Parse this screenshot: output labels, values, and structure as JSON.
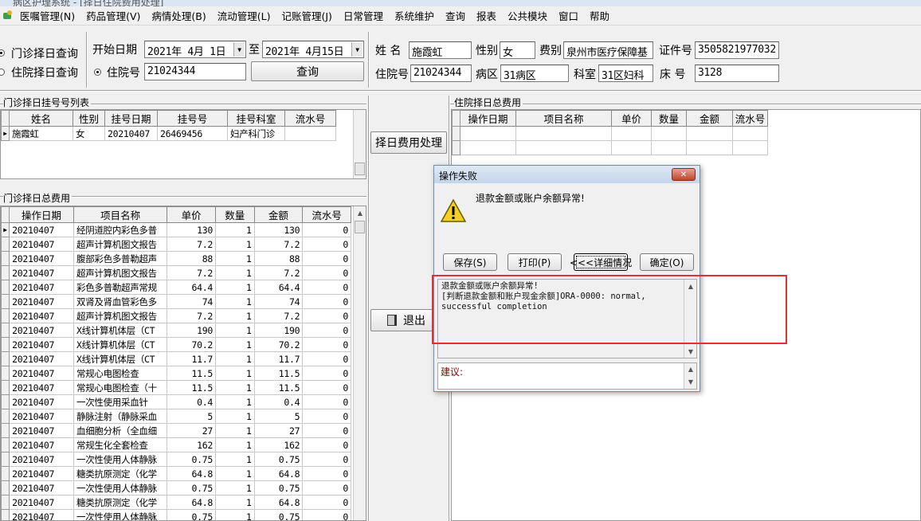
{
  "window_title": "病区护理系统 - [择日住院费用处理]",
  "menu": [
    "医嘱管理(N)",
    "药品管理(V)",
    "病情处理(B)",
    "流动管理(L)",
    "记账管理(J)",
    "日常管理",
    "系统维护",
    "查询",
    "报表",
    "公共模块",
    "窗口",
    "帮助"
  ],
  "query": {
    "radio_outpatient": "门诊择日查询",
    "radio_inpatient": "住院择日查询",
    "start_date_label": "开始日期",
    "start_date": "2021年 4月 1日",
    "to_label": "至",
    "end_date": "2021年 4月15日",
    "inpatient_no_label": "住院号",
    "inpatient_no": "21024344",
    "query_button": "查询"
  },
  "patient": {
    "name_label": "姓 名",
    "name": "施霞虹",
    "gender_label": "性别",
    "gender": "女",
    "fee_type_label": "费别",
    "fee_type": "泉州市医疗保障基",
    "id_label": "证件号",
    "id_no": "3505821977032",
    "inpatient_no_label": "住院号",
    "inpatient_no": "21024344",
    "ward_label": "病区",
    "ward": "31病区",
    "dept_label": "科室",
    "dept": "31区妇科",
    "bed_label": "床 号",
    "bed": "3128"
  },
  "reg_list": {
    "title": "门诊择日挂号号列表",
    "headers": [
      "姓名",
      "性别",
      "挂号日期",
      "挂号号",
      "挂号科室",
      "流水号"
    ],
    "rows": [
      [
        "施霞虹",
        "女",
        "20210407",
        "26469456",
        "妇产科门诊",
        ""
      ]
    ]
  },
  "fee_list": {
    "title": "门诊择日总费用",
    "headers": [
      "操作日期",
      "项目名称",
      "单价",
      "数量",
      "金额",
      "流水号"
    ],
    "rows": [
      [
        "20210407",
        "经阴道腔内彩色多普",
        "130",
        "1",
        "130",
        "0"
      ],
      [
        "20210407",
        "超声计算机图文报告",
        "7.2",
        "1",
        "7.2",
        "0"
      ],
      [
        "20210407",
        "腹部彩色多普勒超声",
        "88",
        "1",
        "88",
        "0"
      ],
      [
        "20210407",
        "超声计算机图文报告",
        "7.2",
        "1",
        "7.2",
        "0"
      ],
      [
        "20210407",
        "彩色多普勒超声常规",
        "64.4",
        "1",
        "64.4",
        "0"
      ],
      [
        "20210407",
        "双肾及肾血管彩色多",
        "74",
        "1",
        "74",
        "0"
      ],
      [
        "20210407",
        "超声计算机图文报告",
        "7.2",
        "1",
        "7.2",
        "0"
      ],
      [
        "20210407",
        "X线计算机体层（CT",
        "190",
        "1",
        "190",
        "0"
      ],
      [
        "20210407",
        "X线计算机体层（CT",
        "70.2",
        "1",
        "70.2",
        "0"
      ],
      [
        "20210407",
        "X线计算机体层（CT",
        "11.7",
        "1",
        "11.7",
        "0"
      ],
      [
        "20210407",
        "常规心电图检查",
        "11.5",
        "1",
        "11.5",
        "0"
      ],
      [
        "20210407",
        "常规心电图检查（十",
        "11.5",
        "1",
        "11.5",
        "0"
      ],
      [
        "20210407",
        "一次性使用采血针",
        "0.4",
        "1",
        "0.4",
        "0"
      ],
      [
        "20210407",
        "静脉注射（静脉采血",
        "5",
        "1",
        "5",
        "0"
      ],
      [
        "20210407",
        "血细胞分析（全血细",
        "27",
        "1",
        "27",
        "0"
      ],
      [
        "20210407",
        "常规生化全套检查",
        "162",
        "1",
        "162",
        "0"
      ],
      [
        "20210407",
        "一次性使用人体静脉",
        "0.75",
        "1",
        "0.75",
        "0"
      ],
      [
        "20210407",
        "糖类抗原测定（化学",
        "64.8",
        "1",
        "64.8",
        "0"
      ],
      [
        "20210407",
        "一次性使用人体静脉",
        "0.75",
        "1",
        "0.75",
        "0"
      ],
      [
        "20210407",
        "糖类抗原测定（化学",
        "64.8",
        "1",
        "64.8",
        "0"
      ],
      [
        "20210407",
        "一次性使用人体静脉",
        "0.75",
        "1",
        "0.75",
        "0"
      ]
    ]
  },
  "actions": {
    "process_button": "择日费用处理",
    "exit_button": "退出"
  },
  "inpatient_fee": {
    "title": "住院择日总费用",
    "headers": [
      "操作日期",
      "项目名称",
      "单价",
      "数量",
      "金额",
      "流水号"
    ]
  },
  "dialog": {
    "title": "操作失败",
    "close": "✕",
    "message": "退款金额或账户余额异常!",
    "buttons": [
      "保存(S)",
      "打印(P)",
      "<<<详细情况",
      "确定(O)"
    ],
    "detail_line1": "退款金额或账户余额异常!",
    "detail_line2": "[判断退款金额和账户现金余额]ORA-0000: normal,",
    "detail_line3": "successful completion",
    "suggestion_label": "建议:"
  },
  "colors": {
    "highlight_box": "#e03030",
    "suggestion_label": "#8b0000"
  }
}
